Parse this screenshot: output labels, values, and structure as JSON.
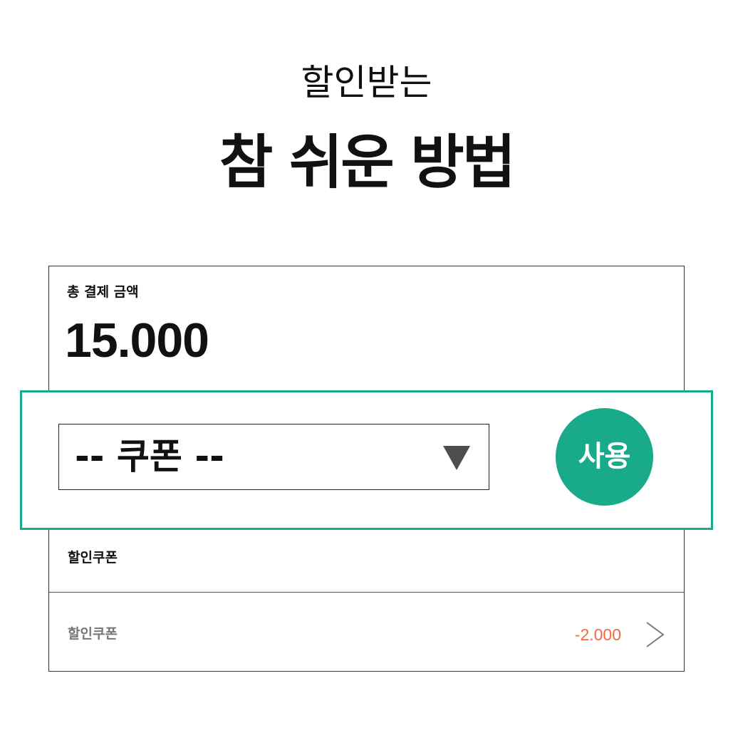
{
  "colors": {
    "accent": "#18aa8b",
    "discount_amount": "#f06b44",
    "muted_text": "#777777"
  },
  "icons": {
    "dropdown_arrow": "caret-down-icon",
    "row_arrow": "chevron-right-icon"
  },
  "heading": {
    "line1": "할인받는",
    "line2": "참 쉬운 방법"
  },
  "payment": {
    "label": "총 결제 금액",
    "amount": "15.000"
  },
  "coupon": {
    "select_value": "-- 쿠폰 --",
    "use_button": "사용"
  },
  "discount": {
    "section_label": "할인쿠폰",
    "rows": [
      {
        "label": "할인쿠폰",
        "amount": "-2.000"
      }
    ]
  }
}
